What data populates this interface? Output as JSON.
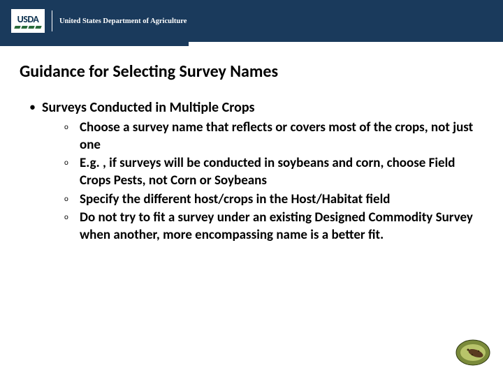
{
  "header": {
    "logo_text": "USDA",
    "department_name": "United States Department of Agriculture"
  },
  "slide": {
    "title": "Guidance for Selecting Survey Names",
    "bullets": [
      {
        "heading": "Surveys Conducted in Multiple Crops",
        "sub": [
          "Choose a survey name that reflects or covers most of the crops, not just one",
          "E.g. , if surveys will be conducted in soybeans and corn, choose Field Crops Pests, not Corn or Soybeans",
          "Specify the different host/crops in the Host/Habitat field",
          "Do not try to fit a survey under an existing Designed Commodity Survey when another, more encompassing name is a better fit."
        ]
      }
    ]
  },
  "colors": {
    "header_band": "#1a3a5c",
    "badge_fill": "#7a8a3a",
    "badge_highlight": "#b8c46a"
  }
}
